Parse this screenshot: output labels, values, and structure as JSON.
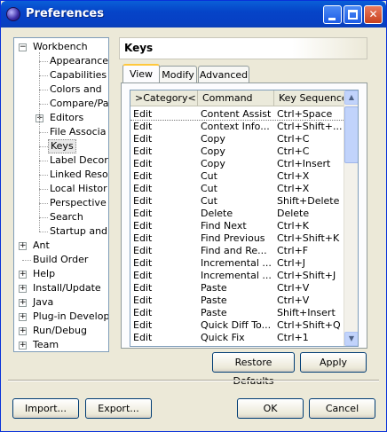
{
  "window": {
    "title": "Preferences"
  },
  "tree": {
    "items": [
      {
        "label": "Workbench",
        "expander": "−",
        "depth": 0
      },
      {
        "label": "Appearance",
        "depth": 1
      },
      {
        "label": "Capabilities",
        "depth": 1
      },
      {
        "label": "Colors and",
        "depth": 1
      },
      {
        "label": "Compare/Pa",
        "depth": 1
      },
      {
        "label": "Editors",
        "expander": "+",
        "depth": 1
      },
      {
        "label": "File Associa",
        "depth": 1
      },
      {
        "label": "Keys",
        "depth": 1,
        "selected": true
      },
      {
        "label": "Label Decor",
        "depth": 1
      },
      {
        "label": "Linked Reso",
        "depth": 1
      },
      {
        "label": "Local Histor",
        "depth": 1
      },
      {
        "label": "Perspective",
        "depth": 1
      },
      {
        "label": "Search",
        "depth": 1
      },
      {
        "label": "Startup and",
        "depth": 1
      },
      {
        "label": "Ant",
        "expander": "+",
        "depth": 0
      },
      {
        "label": "Build Order",
        "depth": 0
      },
      {
        "label": "Help",
        "expander": "+",
        "depth": 0
      },
      {
        "label": "Install/Update",
        "expander": "+",
        "depth": 0
      },
      {
        "label": "Java",
        "expander": "+",
        "depth": 0
      },
      {
        "label": "Plug-in Develop",
        "expander": "+",
        "depth": 0
      },
      {
        "label": "Run/Debug",
        "expander": "+",
        "depth": 0
      },
      {
        "label": "Team",
        "expander": "+",
        "depth": 0
      }
    ]
  },
  "page": {
    "title": "Keys"
  },
  "tabs": {
    "view": "View",
    "modify": "Modify",
    "advanced": "Advanced"
  },
  "table": {
    "headers": [
      ">Category<",
      "Command",
      "Key Sequence"
    ],
    "rows": [
      [
        "Edit",
        "Content Assist",
        "Ctrl+Space"
      ],
      [
        "Edit",
        "Context Info...",
        "Ctrl+Shift+..."
      ],
      [
        "Edit",
        "Copy",
        "Ctrl+C"
      ],
      [
        "Edit",
        "Copy",
        "Ctrl+C"
      ],
      [
        "Edit",
        "Copy",
        "Ctrl+Insert"
      ],
      [
        "Edit",
        "Cut",
        "Ctrl+X"
      ],
      [
        "Edit",
        "Cut",
        "Ctrl+X"
      ],
      [
        "Edit",
        "Cut",
        "Shift+Delete"
      ],
      [
        "Edit",
        "Delete",
        "Delete"
      ],
      [
        "Edit",
        "Find Next",
        "Ctrl+K"
      ],
      [
        "Edit",
        "Find Previous",
        "Ctrl+Shift+K"
      ],
      [
        "Edit",
        "Find and Re...",
        "Ctrl+F"
      ],
      [
        "Edit",
        "Incremental ...",
        "Ctrl+J"
      ],
      [
        "Edit",
        "Incremental ...",
        "Ctrl+Shift+J"
      ],
      [
        "Edit",
        "Paste",
        "Ctrl+V"
      ],
      [
        "Edit",
        "Paste",
        "Ctrl+V"
      ],
      [
        "Edit",
        "Paste",
        "Shift+Insert"
      ],
      [
        "Edit",
        "Quick Diff To...",
        "Ctrl+Shift+Q"
      ],
      [
        "Edit",
        "Quick Fix",
        "Ctrl+1"
      ]
    ]
  },
  "buttons": {
    "restore_defaults": "Restore Defaults",
    "apply": "Apply",
    "import": "Import...",
    "export": "Export...",
    "ok": "OK",
    "cancel": "Cancel"
  },
  "icons": {
    "app": "eclipse-icon",
    "minimize": "minimize-icon",
    "maximize": "maximize-icon",
    "close": "close-icon"
  },
  "colors": {
    "titlebar": "#0544c8",
    "dialog_bg": "#ece9d8",
    "selection": "#e8e8e8"
  }
}
